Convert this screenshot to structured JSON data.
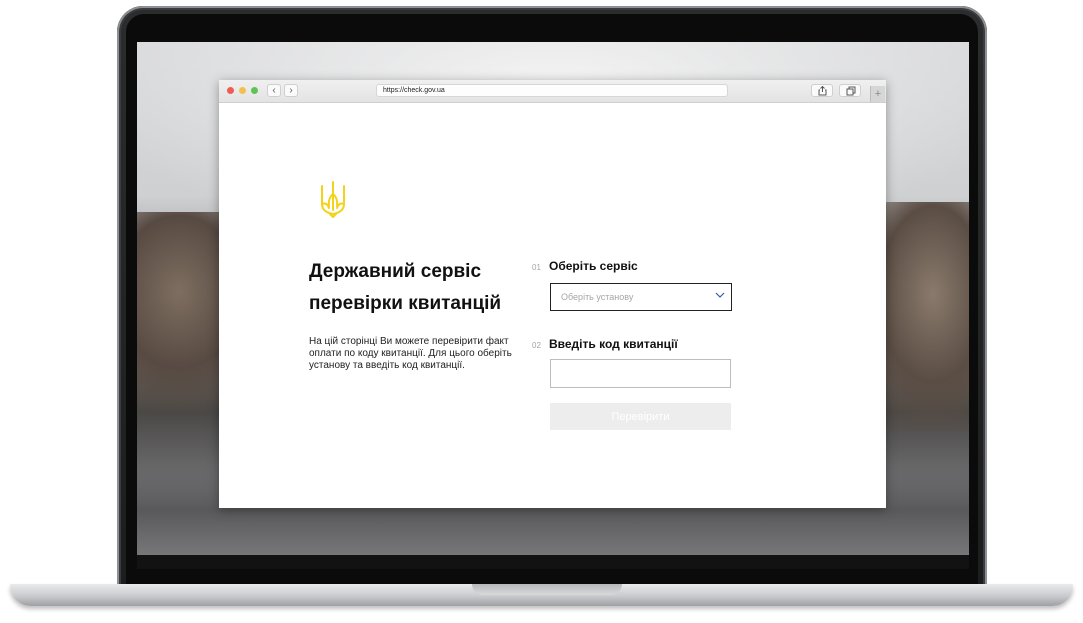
{
  "browser": {
    "url": "https://check.gov.ua",
    "nav": {
      "back_glyph": "‹",
      "forward_glyph": "›"
    },
    "new_tab_glyph": "+",
    "icons": [
      "close-light",
      "minimize-light",
      "maximize-light",
      "share-icon",
      "tabs-icon",
      "plus-icon"
    ]
  },
  "page": {
    "logo_icon": "trident-icon",
    "accent_color": "#f5d21a",
    "title_line1": "Державний сервіс",
    "title_line2": "перевірки квитанцій",
    "description": "На цій сторінці Ви можете перевірити факт оплати по коду квитанції. Для цього оберіть установу та введіть код квитанції.",
    "step1": {
      "number": "01",
      "label": "Оберіть сервіс",
      "select_placeholder": "Оберіть установу"
    },
    "step2": {
      "number": "02",
      "label": "Введіть код квитанції",
      "input_value": ""
    },
    "submit_label": "Перевірити"
  }
}
